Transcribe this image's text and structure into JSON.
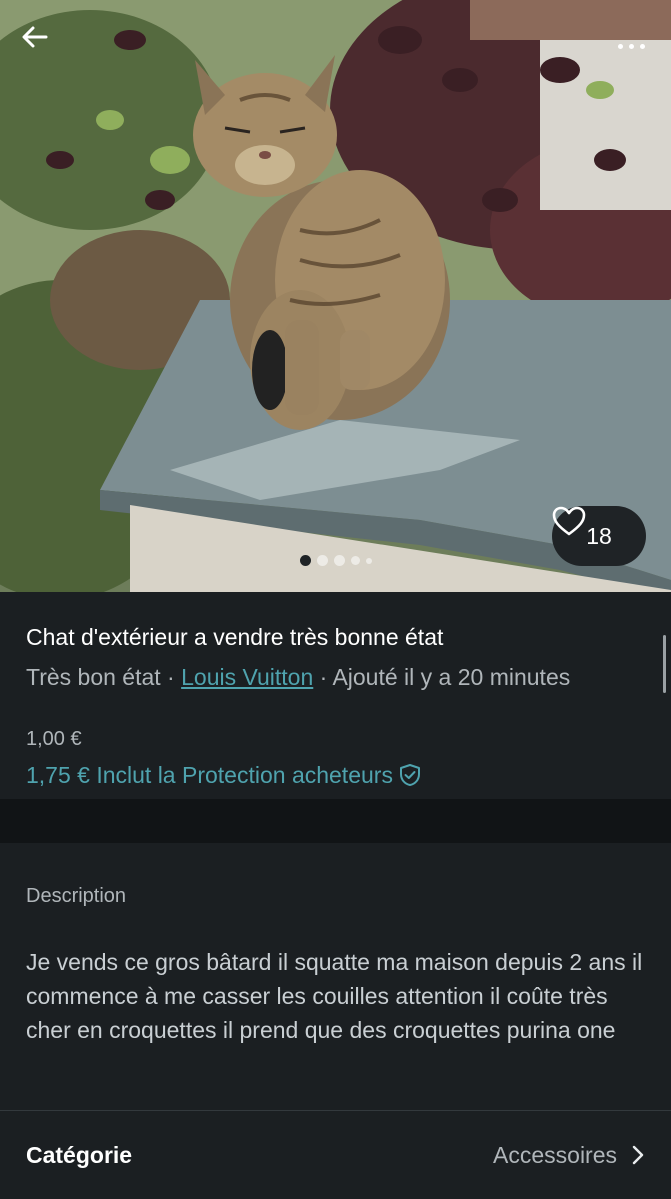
{
  "header": {
    "back_icon": "arrow-left-icon",
    "more_icon": "more-horizontal-icon"
  },
  "photo": {
    "subject": "tabby cat photo",
    "likes": "18",
    "like_icon": "heart-outline-icon",
    "carousel": {
      "total": 5,
      "active_index": 0
    }
  },
  "listing": {
    "title": "Chat d'extérieur a vendre très bonne état",
    "condition": "Très bon état",
    "separator": " · ",
    "brand": "Louis Vuitton",
    "added": "Ajouté il y a 20 minutes",
    "price": "1,00 €",
    "price_with_protection": "1,75 € Inclut la Protection acheteurs",
    "protection_icon": "shield-check-icon"
  },
  "description": {
    "label": "Description",
    "text": "Je vends ce gros bâtard il squatte ma maison depuis 2 ans il commence à me casser les couilles attention il coûte très cher en croquettes il prend que des croquettes purina one"
  },
  "category": {
    "label": "Catégorie",
    "value": "Accessoires",
    "chevron_icon": "chevron-right-icon"
  },
  "colors": {
    "background": "#1b1f22",
    "accent": "#4fa3ae",
    "muted_text": "#b0b6ba"
  }
}
